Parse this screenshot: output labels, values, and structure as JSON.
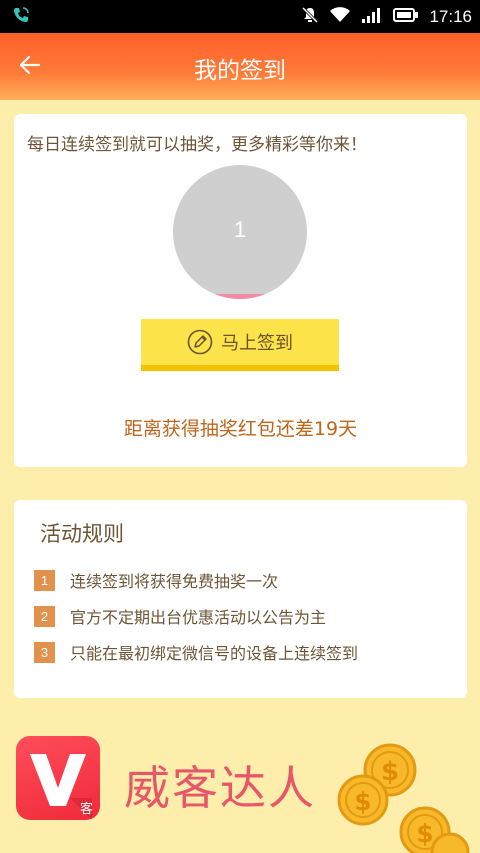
{
  "status_bar": {
    "time": "17:16",
    "icons": [
      "phone-call-icon",
      "notification-muted-icon",
      "wifi-icon",
      "signal-icon",
      "battery-icon"
    ]
  },
  "header": {
    "title": "我的签到",
    "back_icon": "arrow-left-icon",
    "gradient_colors": [
      "#ff5f2a",
      "#ffb05a"
    ]
  },
  "checkin": {
    "promo_text": "每日连续签到就可以抽奖，更多精彩等你来！",
    "streak_count": "1",
    "button_label": "马上签到",
    "button_icon": "pencil-icon",
    "remaining_text": "距离获得抽奖红包还差19天"
  },
  "rules": {
    "title": "活动规则",
    "items": [
      {
        "num": "1",
        "text": "连续签到将获得免费抽奖一次"
      },
      {
        "num": "2",
        "text": "官方不定期出台优惠活动以公告为主"
      },
      {
        "num": "3",
        "text": "只能在最初绑定微信号的设备上连续签到"
      }
    ]
  },
  "footer": {
    "brand_name": "威客达人",
    "logo_glyph": "客",
    "coins_icon": "dollar-coins-icon"
  },
  "colors": {
    "background": "#fdeeab",
    "button": "#fde34a",
    "accent_text": "#c0661c",
    "rule_badge": "#e3924d",
    "brand": "#e8566a"
  }
}
